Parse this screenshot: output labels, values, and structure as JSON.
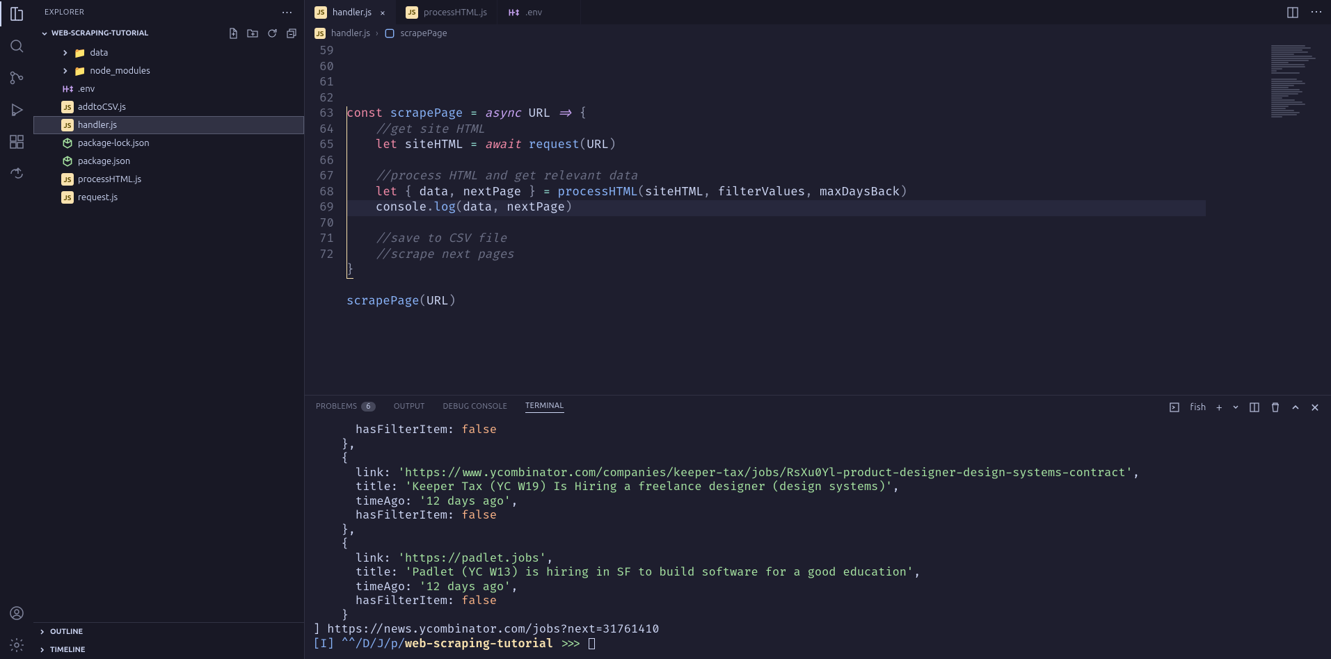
{
  "explorer": {
    "title": "EXPLORER",
    "project": "WEB-SCRAPING-TUTORIAL",
    "tree": [
      {
        "kind": "folder",
        "label": "data",
        "icon": "📁",
        "color": "#f9e2af",
        "expanded": false,
        "indent": 1
      },
      {
        "kind": "folder",
        "label": "node_modules",
        "icon": "📁",
        "color": "#a6e3a1",
        "expanded": false,
        "indent": 1
      },
      {
        "kind": "file",
        "label": ".env",
        "iconType": "env",
        "indent": 1
      },
      {
        "kind": "file",
        "label": "addtoCSV.js",
        "iconType": "js",
        "indent": 1
      },
      {
        "kind": "file",
        "label": "handler.js",
        "iconType": "js",
        "indent": 1,
        "active": true
      },
      {
        "kind": "file",
        "label": "package-lock.json",
        "iconType": "json",
        "indent": 1
      },
      {
        "kind": "file",
        "label": "package.json",
        "iconType": "json",
        "indent": 1
      },
      {
        "kind": "file",
        "label": "processHTML.js",
        "iconType": "js",
        "indent": 1
      },
      {
        "kind": "file",
        "label": "request.js",
        "iconType": "js",
        "indent": 1
      }
    ],
    "outline_label": "OUTLINE",
    "timeline_label": "TIMELINE"
  },
  "tabs": [
    {
      "label": "handler.js",
      "iconType": "js",
      "active": true,
      "dirty": false
    },
    {
      "label": "processHTML.js",
      "iconType": "js",
      "active": false
    },
    {
      "label": ".env",
      "iconType": "env",
      "active": false
    }
  ],
  "breadcrumb": {
    "file": "handler.js",
    "symbol": "scrapePage"
  },
  "editor": {
    "firstLine": 59,
    "activeLine": 69,
    "lines": [
      "",
      "const scrapePage = async URL => {",
      "    //get site HTML",
      "    let siteHTML = await request(URL)",
      "",
      "    //process HTML and get relevant data",
      "    let { data, nextPage } = processHTML(siteHTML, filterValues, maxDaysBack)",
      "    console.log(data, nextPage)",
      "",
      "    //save to CSV file",
      "    //scrape next pages",
      "}",
      "",
      "scrapePage(URL)"
    ]
  },
  "panel": {
    "tabs": {
      "problems": "PROBLEMS",
      "problems_badge": "6",
      "output": "OUTPUT",
      "debug": "DEBUG CONSOLE",
      "terminal": "TERMINAL"
    },
    "shell": "fish",
    "terminal_lines": [
      {
        "indent": "      ",
        "text": "hasFilterItem: ",
        "val": "false",
        "valClass": "t-false"
      },
      {
        "raw": "    },"
      },
      {
        "raw": "    {"
      },
      {
        "indent": "      ",
        "key": "link: ",
        "str": "'https://www.ycombinator.com/companies/keeper-tax/jobs/RsXu0Yl-product-designer-design-systems-contract'",
        "tail": ","
      },
      {
        "indent": "      ",
        "key": "title: ",
        "str": "'Keeper Tax (YC W19) Is Hiring a freelance designer (design systems)'",
        "tail": ","
      },
      {
        "indent": "      ",
        "key": "timeAgo: ",
        "str": "'12 days ago'",
        "tail": ","
      },
      {
        "indent": "      ",
        "text": "hasFilterItem: ",
        "val": "false",
        "valClass": "t-false"
      },
      {
        "raw": "    },"
      },
      {
        "raw": "    {"
      },
      {
        "indent": "      ",
        "key": "link: ",
        "str": "'https://padlet.jobs'",
        "tail": ","
      },
      {
        "indent": "      ",
        "key": "title: ",
        "str": "'Padlet (YC W13) is hiring in SF to build software for a good education'",
        "tail": ","
      },
      {
        "indent": "      ",
        "key": "timeAgo: ",
        "str": "'12 days ago'",
        "tail": ","
      },
      {
        "indent": "      ",
        "text": "hasFilterItem: ",
        "val": "false",
        "valClass": "t-false"
      },
      {
        "raw": "    }"
      },
      {
        "raw": "] https://news.ycombinator.com/jobs?next=31761410"
      }
    ],
    "prompt": {
      "mode": "[I]",
      "path": "^^/D/J/p/",
      "proj": "web-scraping-tutorial",
      "arrows": " >>> "
    }
  }
}
